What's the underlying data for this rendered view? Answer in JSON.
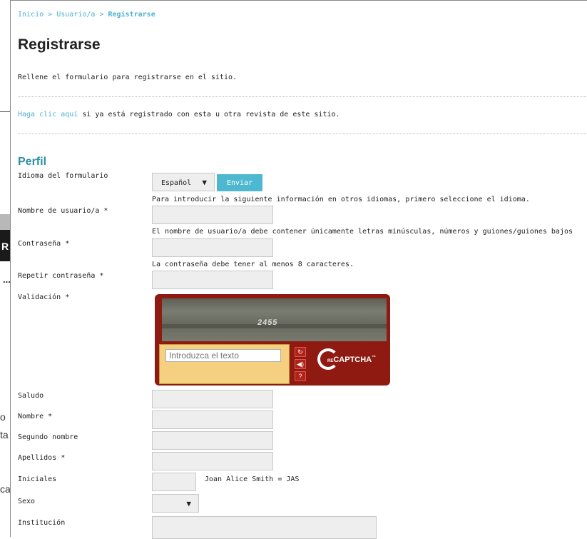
{
  "background_window": {
    "dots": "...",
    "letter": "R",
    "fragments": [
      "o",
      "ta",
      "ca"
    ]
  },
  "breadcrumb": {
    "home": "Inicio",
    "separator": ">",
    "user": "Usuario/a",
    "current": "Registrarse"
  },
  "page_title": "Registrarse",
  "intro_text": "Rellene el formulario para registrarse en el sitio.",
  "already_registered": {
    "link": "Haga clic aquí",
    "text": " si ya está registrado con esta u otra revista de este sitio."
  },
  "section_title": "Perfil",
  "form": {
    "language_label": "Idioma del formulario",
    "language_value": "Español",
    "submit_label": "Enviar",
    "language_hint": "Para introducir la siguiente información en otros idiomas, primero seleccione el idioma.",
    "username_label": "Nombre de usuario/a *",
    "username_hint": "El nombre de usuario/a debe contener únicamente letras minúsculas, números y guiones/guiones bajos",
    "password_label": "Contraseña *",
    "password_hint": "La contraseña debe tener al menos 8 caracteres.",
    "repeat_password_label": "Repetir contraseña *",
    "validation_label": "Validación *",
    "salutation_label": "Saludo",
    "first_name_label": "Nombre *",
    "middle_name_label": "Segundo nombre",
    "last_name_label": "Apellidos *",
    "initials_label": "Iniciales",
    "initials_example": "Joan Alice Smith = JAS",
    "gender_label": "Sexo",
    "gender_value": "",
    "institution_label": "Institución"
  },
  "captcha": {
    "image_code": "2455",
    "placeholder": "Introduzca el texto",
    "refresh_glyph": "↻",
    "audio_glyph": "◀)",
    "help_glyph": "?",
    "logo_prefix": "RE",
    "logo_text": "CAPTCHA",
    "trademark": "™"
  },
  "colors": {
    "accent": "#4db1d2",
    "section_title": "#2a8fa8",
    "button": "#4db8cf",
    "captcha_bg": "#8e1a12",
    "captcha_input_bg": "#f5d081",
    "field_bg": "#eeeeee"
  }
}
